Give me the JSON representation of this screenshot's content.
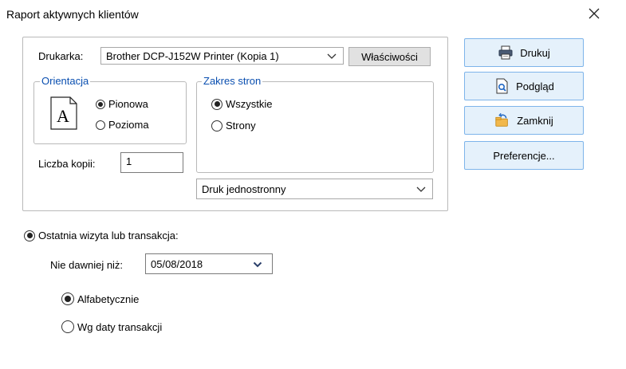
{
  "window": {
    "title": "Raport aktywnych klientów"
  },
  "printer": {
    "label": "Drukarka:",
    "selected": "Brother DCP-J152W Printer (Kopia 1)",
    "properties_button": "Właściwości"
  },
  "orientation": {
    "legend": "Orientacja",
    "icon_letter": "A",
    "options": [
      {
        "label": "Pionowa",
        "checked": true
      },
      {
        "label": "Pozioma",
        "checked": false
      }
    ]
  },
  "page_range": {
    "legend": "Zakres stron",
    "options": [
      {
        "label": "Wszystkie",
        "checked": true
      },
      {
        "label": "Strony",
        "checked": false
      }
    ]
  },
  "copies": {
    "label": "Liczba kopii:",
    "value": "1"
  },
  "duplex": {
    "selected": "Druk jednostronny"
  },
  "buttons": {
    "print": "Drukuj",
    "preview": "Podgląd",
    "close": "Zamknij",
    "preferences": "Preferencje..."
  },
  "filter": {
    "last_visit_label": "Ostatnia wizyta lub transakcja:",
    "not_older_label": "Nie dawniej niż:",
    "date_value": "05/08/2018",
    "sort_options": [
      {
        "label": "Alfabetycznie",
        "checked": true
      },
      {
        "label": "Wg daty transakcji",
        "checked": false
      }
    ]
  },
  "colors": {
    "legend_blue": "#0a4fb0",
    "button_face": "#e5f1fb",
    "button_border": "#7eb4ea"
  }
}
